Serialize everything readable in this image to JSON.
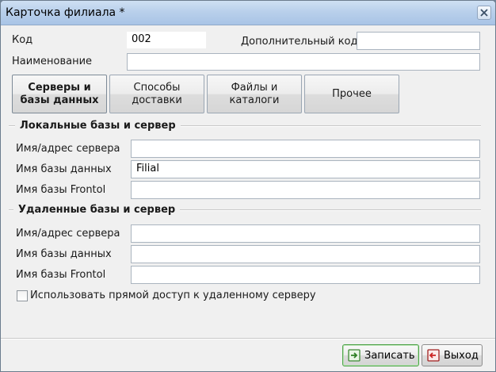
{
  "window": {
    "title": "Карточка филиала *",
    "close_icon": "close-icon"
  },
  "header": {
    "code_label": "Код",
    "code_value": "002",
    "extra_code_label": "Дополнительный код",
    "extra_code_value": "",
    "name_label": "Наименование",
    "name_value": ""
  },
  "tabs": [
    {
      "label": "Серверы и базы данных",
      "active": true
    },
    {
      "label": "Способы доставки",
      "active": false
    },
    {
      "label": "Файлы и каталоги",
      "active": false
    },
    {
      "label": "Прочее",
      "active": false
    }
  ],
  "local": {
    "title": "Локальные базы и сервер",
    "server_label": "Имя/адрес сервера",
    "server_value": "",
    "db_label": "Имя базы данных",
    "db_value": "Filial",
    "frontol_label": "Имя базы Frontol",
    "frontol_value": ""
  },
  "remote": {
    "title": "Удаленные  базы и сервер",
    "server_label": "Имя/адрес сервера",
    "server_value": "",
    "db_label": "Имя базы данных",
    "db_value": "",
    "frontol_label": "Имя базы Frontol",
    "frontol_value": ""
  },
  "direct_access": {
    "label": "Использовать прямой доступ к удаленному серверу",
    "checked": false
  },
  "footer": {
    "save_label": "Записать",
    "save_icon": "save-icon",
    "exit_label": "Выход",
    "exit_icon": "exit-icon",
    "save_border_color": "#4fa34a",
    "exit_icon_color": "#cc2222"
  }
}
